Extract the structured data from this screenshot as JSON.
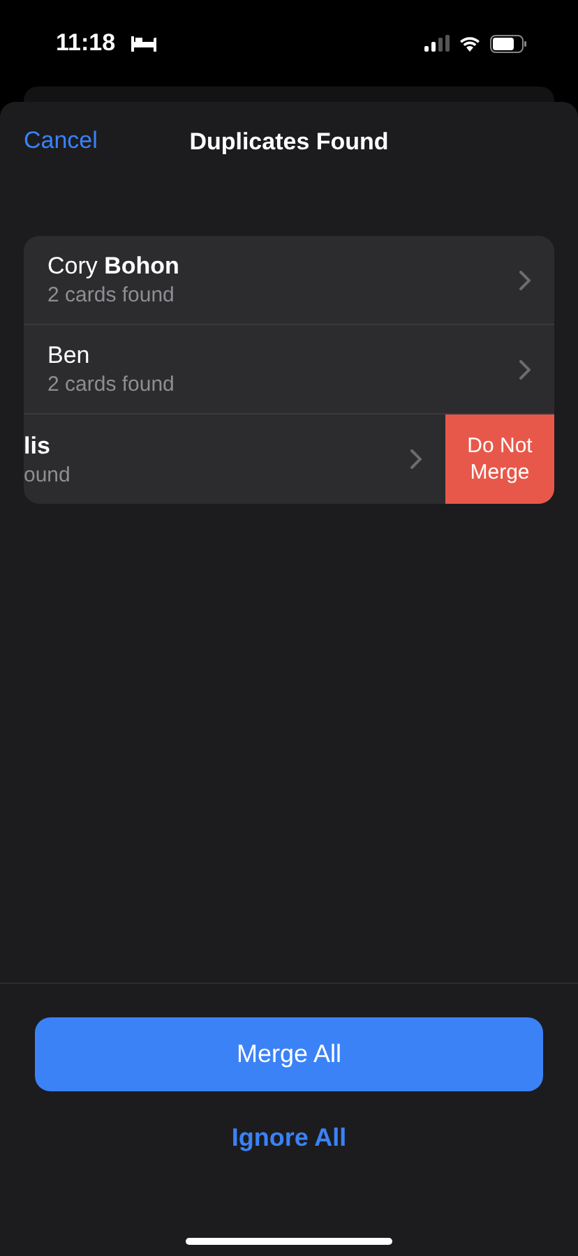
{
  "status_bar": {
    "time": "11:18"
  },
  "nav": {
    "cancel": "Cancel",
    "title": "Duplicates Found"
  },
  "rows": [
    {
      "kind": "normal",
      "name": "Cory **Bohon**",
      "detail": "2 cards found"
    },
    {
      "kind": "normal",
      "name": "Ben",
      "detail": "2 cards found"
    },
    {
      "kind": "swiped",
      "name": "**lis**",
      "detail": "ound",
      "action": "Do Not Merge"
    }
  ],
  "footer": {
    "primary": "Merge All",
    "secondary": "Ignore All"
  }
}
